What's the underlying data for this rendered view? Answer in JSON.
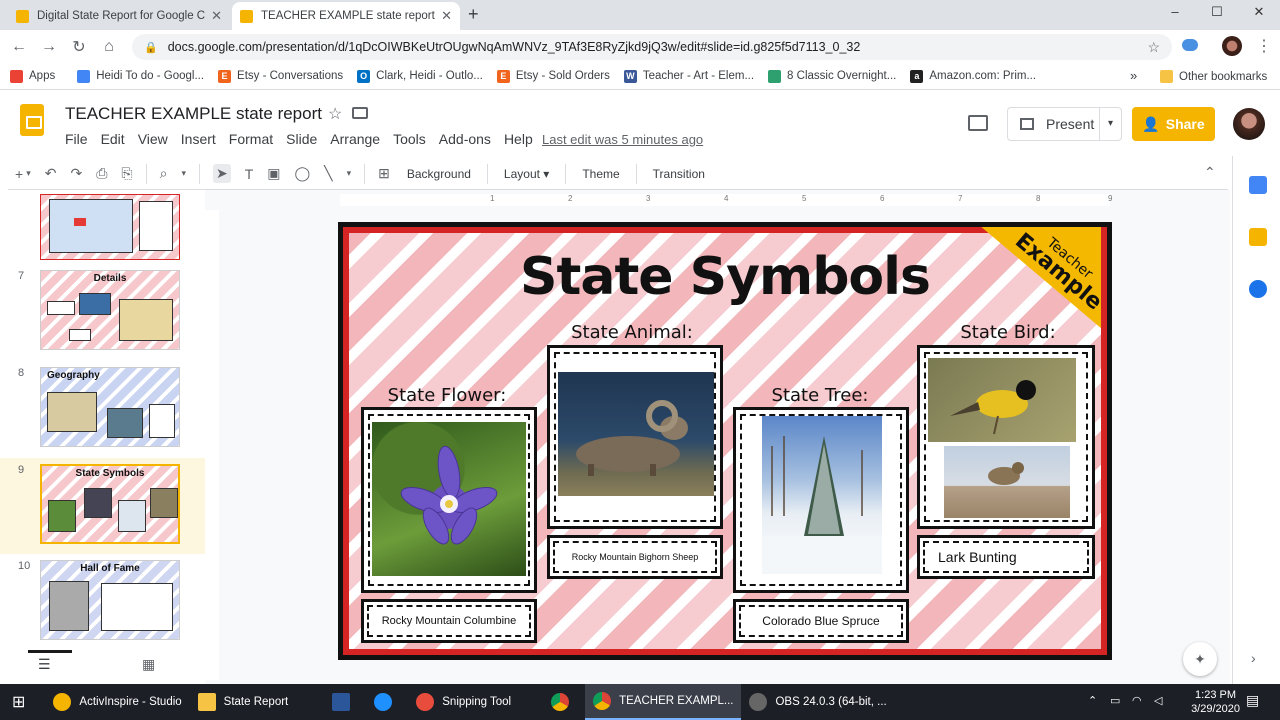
{
  "browser": {
    "tabs": [
      {
        "title": "Digital State Report for Google C",
        "active": false
      },
      {
        "title": "TEACHER EXAMPLE state report",
        "active": true
      }
    ],
    "new_tab": "+",
    "url": "docs.google.com/presentation/d/1qDcOIWBKeUtrOUgwNqAmWNVz_9TAf3E8RyZjkd9jQ3w/edit#slide=id.g825f5d7113_0_32",
    "window_controls": [
      "–",
      "☐",
      "✕"
    ]
  },
  "bookmarks": [
    {
      "label": "Apps",
      "color": "#ea4335"
    },
    {
      "label": "Heidi To do - Googl...",
      "color": "#4285f4"
    },
    {
      "label": "Etsy - Conversations",
      "color": "#f1641e"
    },
    {
      "label": "Clark, Heidi - Outlo...",
      "color": "#0072c6"
    },
    {
      "label": "Etsy - Sold Orders",
      "color": "#f1641e"
    },
    {
      "label": "Teacher - Art - Elem...",
      "color": "#3b5998"
    },
    {
      "label": "8 Classic Overnight...",
      "color": "#2e9f6e"
    },
    {
      "label": "Amazon.com: Prim...",
      "color": "#222222"
    }
  ],
  "bookmarks_more": "»",
  "other_bookmarks": "Other bookmarks",
  "slides": {
    "doc_title": "TEACHER EXAMPLE state report",
    "menu": [
      "File",
      "Edit",
      "View",
      "Insert",
      "Format",
      "Slide",
      "Arrange",
      "Tools",
      "Add-ons",
      "Help"
    ],
    "last_edit": "Last edit was 5 minutes ago",
    "present_label": "Present",
    "share_label": "Share",
    "toolbar_text": [
      "Background",
      "Layout ▾",
      "Theme",
      "Transition"
    ],
    "ruler_ticks": [
      "1",
      "2",
      "3",
      "4",
      "5",
      "6",
      "7",
      "8",
      "9"
    ]
  },
  "filmstrip": [
    {
      "num": "",
      "label": "",
      "selected": false
    },
    {
      "num": "7",
      "label": "Details",
      "selected": false
    },
    {
      "num": "8",
      "label": "Geography",
      "selected": false
    },
    {
      "num": "9",
      "label": "State Symbols",
      "selected": true
    },
    {
      "num": "10",
      "label": "Hall of Fame",
      "selected": false
    }
  ],
  "slide": {
    "title": "State Symbols",
    "corner_line1": "Teacher",
    "corner_line2": "Example",
    "flower": {
      "heading": "State Flower:",
      "caption": "Rocky Mountain Columbine"
    },
    "animal": {
      "heading": "State Animal:",
      "caption": "Rocky Mountain Bighorn Sheep"
    },
    "tree": {
      "heading": "State Tree:",
      "caption": "Colorado Blue Spruce"
    },
    "bird": {
      "heading": "State Bird:",
      "caption": "Lark Bunting"
    }
  },
  "taskbar": {
    "items": [
      {
        "label": "ActivInspire - Studio",
        "color": "#f4b400",
        "active": false
      },
      {
        "label": "State Report",
        "color": "#f6c344",
        "active": false
      },
      {
        "label": "",
        "color": "#2b579a",
        "active": false
      },
      {
        "label": "",
        "color": "#1e90ff",
        "active": false
      },
      {
        "label": "Snipping Tool",
        "color": "#e74c3c",
        "active": false
      },
      {
        "label": "",
        "color": "#4caf50",
        "active": false
      },
      {
        "label": "TEACHER EXAMPL...",
        "color": "#db4437",
        "active": true
      },
      {
        "label": "OBS 24.0.3 (64-bit, ...",
        "color": "#666666",
        "active": false
      }
    ],
    "time": "1:23 PM",
    "date": "3/29/2020"
  }
}
